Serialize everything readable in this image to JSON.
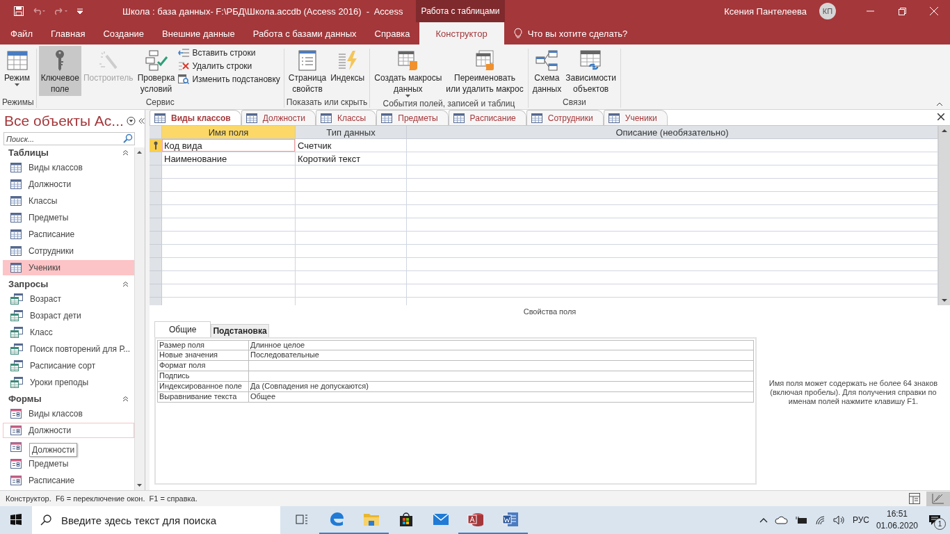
{
  "title_bar": {
    "title": "Школа : база данных- F:\\РБД\\Школа.accdb (Access 2016)  -  Access",
    "context_tab": "Работа с таблицами",
    "user": "Ксения Пантелеева",
    "avatar": "КП"
  },
  "ribbon_tabs": [
    {
      "label": "Файл",
      "selected": false
    },
    {
      "label": "Главная",
      "selected": false
    },
    {
      "label": "Создание",
      "selected": false
    },
    {
      "label": "Внешние данные",
      "selected": false
    },
    {
      "label": "Работа с базами данных",
      "selected": false
    },
    {
      "label": "Справка",
      "selected": false
    },
    {
      "label": "Конструктор",
      "selected": true
    }
  ],
  "tell_me": "Что вы хотите сделать?",
  "ribbon_groups": [
    {
      "label": "Режимы",
      "items": [
        {
          "kind": "large",
          "label": "Режим",
          "dropdown": true,
          "selected": false,
          "disabled": false
        }
      ]
    },
    {
      "label": "Сервис",
      "items": [
        {
          "kind": "large",
          "label": "Ключевое\nполе",
          "selected": true,
          "disabled": false
        },
        {
          "kind": "large",
          "label": "Построитель",
          "selected": false,
          "disabled": true
        },
        {
          "kind": "large",
          "label": "Проверка\nусловий",
          "selected": false,
          "disabled": false
        },
        {
          "kind": "small",
          "label": "Вставить строки",
          "selected": false,
          "disabled": false
        },
        {
          "kind": "small",
          "label": "Удалить строки",
          "selected": false,
          "disabled": false
        },
        {
          "kind": "small",
          "label": "Изменить подстановку",
          "selected": false,
          "disabled": false
        }
      ]
    },
    {
      "label": "Показать или скрыть",
      "items": [
        {
          "kind": "large",
          "label": "Страница\nсвойств",
          "selected": false,
          "disabled": false
        },
        {
          "kind": "large",
          "label": "Индексы",
          "selected": false,
          "disabled": false
        }
      ]
    },
    {
      "label": "События полей, записей и таблиц",
      "items": [
        {
          "kind": "large",
          "label": "Создать макросы\nданных",
          "dropdown": true,
          "selected": false,
          "disabled": false
        },
        {
          "kind": "large",
          "label": "Переименовать\nили удалить макрос",
          "selected": false,
          "disabled": false
        }
      ]
    },
    {
      "label": "Связи",
      "items": [
        {
          "kind": "large",
          "label": "Схема\nданных",
          "selected": false,
          "disabled": false
        },
        {
          "kind": "large",
          "label": "Зависимости\nобъектов",
          "selected": false,
          "disabled": false
        }
      ]
    }
  ],
  "nav": {
    "title": "Все объекты Ac...",
    "search_placeholder": "Поиск...",
    "groups": [
      {
        "label": "Таблицы",
        "kind": "table",
        "expanded": true,
        "items": [
          {
            "label": "Виды классов",
            "selected": false,
            "focused": false
          },
          {
            "label": "Должности",
            "selected": false,
            "focused": false
          },
          {
            "label": "Классы",
            "selected": false,
            "focused": false
          },
          {
            "label": "Предметы",
            "selected": false,
            "focused": false
          },
          {
            "label": "Расписание",
            "selected": false,
            "focused": false
          },
          {
            "label": "Сотрудники",
            "selected": false,
            "focused": false
          },
          {
            "label": "Ученики",
            "selected": true,
            "focused": false
          }
        ]
      },
      {
        "label": "Запросы",
        "kind": "query",
        "expanded": true,
        "items": [
          {
            "label": "Возраст",
            "selected": false,
            "focused": false
          },
          {
            "label": "Возраст дети",
            "selected": false,
            "focused": false
          },
          {
            "label": "Класс",
            "selected": false,
            "focused": false
          },
          {
            "label": "Поиск повторений для Р...",
            "selected": false,
            "focused": false
          },
          {
            "label": "Расписание сорт",
            "selected": false,
            "focused": false
          },
          {
            "label": "Уроки преподы",
            "selected": false,
            "focused": false
          }
        ]
      },
      {
        "label": "Формы",
        "kind": "form",
        "expanded": true,
        "items": [
          {
            "label": "Виды классов",
            "selected": false,
            "focused": false
          },
          {
            "label": "Должности",
            "selected": false,
            "focused": true
          },
          {
            "tooltip": "Должности",
            "selected": false,
            "focused": false
          },
          {
            "label": "Предметы",
            "selected": false,
            "focused": false
          },
          {
            "label": "Расписание",
            "selected": false,
            "focused": false
          }
        ]
      }
    ]
  },
  "doc_tabs": [
    {
      "label": "Виды классов",
      "selected": true
    },
    {
      "label": "Должности",
      "selected": false
    },
    {
      "label": "Классы",
      "selected": false
    },
    {
      "label": "Предметы",
      "selected": false
    },
    {
      "label": "Расписание",
      "selected": false
    },
    {
      "label": "Сотрудники",
      "selected": false
    },
    {
      "label": "Ученики",
      "selected": false
    }
  ],
  "design_grid": {
    "columns": [
      "Имя поля",
      "Тип данных",
      "Описание (необязательно)"
    ],
    "rows": [
      {
        "name": "Код вида",
        "type": "Счетчик",
        "primary_key": true,
        "current": true
      },
      {
        "name": "Наименование",
        "type": "Короткий текст",
        "primary_key": false,
        "current": false
      }
    ]
  },
  "field_properties": {
    "title": "Свойства поля",
    "tabs": [
      {
        "label": "Общие",
        "selected": true
      },
      {
        "label": "Подстановка",
        "selected": false
      }
    ],
    "rows": [
      {
        "label": "Размер поля",
        "value": "Длинное целое"
      },
      {
        "label": "Новые значения",
        "value": "Последовательные"
      },
      {
        "label": "Формат поля"
      },
      {
        "label": "Подпись"
      },
      {
        "label": "Индексированное поле",
        "value": "Да (Совпадения не допускаются)"
      },
      {
        "label": "Выравнивание текста",
        "value": "Общее"
      }
    ],
    "help": "Имя поля может содержать не более 64 знаков (включая пробелы). Для получения справки по именам полей нажмите клавишу F1."
  },
  "status_bar": {
    "text": "Конструктор.  F6 = переключение окон.  F1 = справка.",
    "views": [
      {
        "selected": false
      },
      {
        "selected": true
      }
    ]
  },
  "taskbar": {
    "search_placeholder": "Введите здесь текст для поиска",
    "apps": [
      {
        "kind": "edge",
        "running": true
      },
      {
        "kind": "explorer",
        "running": true
      },
      {
        "kind": "store",
        "running": false
      },
      {
        "kind": "mail",
        "running": false
      },
      {
        "kind": "access",
        "running": true
      },
      {
        "kind": "word",
        "running": true
      }
    ],
    "language": "РУС",
    "time": "16:51",
    "date": "01.06.2020",
    "notifications": "1"
  }
}
